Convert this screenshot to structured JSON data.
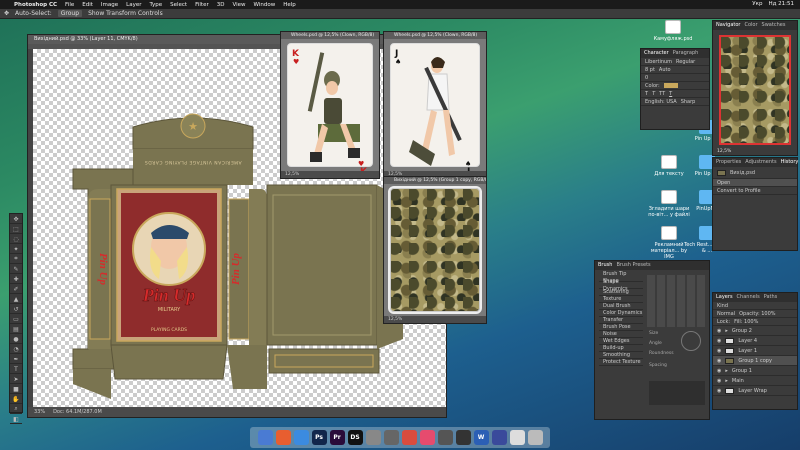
{
  "menubar": {
    "app": "Photoshop CC",
    "items": [
      "File",
      "Edit",
      "Image",
      "Layer",
      "Type",
      "Select",
      "Filter",
      "3D",
      "View",
      "Window",
      "Help"
    ],
    "status": [
      "Укр",
      "Нд 21:51"
    ]
  },
  "options": {
    "auto_select": "Auto-Select:",
    "group": "Group",
    "transform": "Show Transform Controls"
  },
  "main_doc": {
    "title": "Вихідний.psd @ 33% (Layer 11, CMYK/8)",
    "zoom": "33%",
    "doc_size": "Doc: 64.1M/287.0M"
  },
  "card1": {
    "title": "Wheels.psd @ 12,5% (Сlown, RGB/8)",
    "zoom": "12,5%"
  },
  "card2": {
    "title": "Wheels.psd @ 12,5% (Сlown, RGB/8)",
    "zoom": "12,5%"
  },
  "card3": {
    "title": "Вихідний @ 12,5% (Group 1 copy, RGB/8)",
    "zoom": "12,5%"
  },
  "box": {
    "brand": "Pin Up",
    "subtitle": "MILITARY",
    "playing": "PLAYING CARDS",
    "topline": "AMERICAN VINTAGE PLAYING CARDS"
  },
  "desktop_icons": [
    {
      "label": "Камуфляж.psd",
      "kind": "doc"
    },
    {
      "label": "Pin Up Mil",
      "kind": "folder"
    },
    {
      "label": "Для тексту",
      "kind": "doc"
    },
    {
      "label": "Pin Up Mil",
      "kind": "folder"
    },
    {
      "label": "Згладити шари по-віт... у файлі",
      "kind": "doc"
    },
    {
      "label": "PinUpMil",
      "kind": "folder"
    },
    {
      "label": "Рекламний матеріал... by IMG",
      "kind": "doc"
    },
    {
      "label": "Tech Rest... Hands & ...",
      "kind": "folder"
    }
  ],
  "navigator": {
    "tabs": [
      "Navigator",
      "Color",
      "Swatches"
    ],
    "zoom": "12,5%"
  },
  "character": {
    "tabs": [
      "Character",
      "Paragraph"
    ],
    "font": "Libertinum",
    "style": "Regular",
    "size": "8 pt",
    "leading": "Auto",
    "tracking": "0",
    "color_label": "Color:",
    "lang": "English: USA",
    "aa": "Sharp"
  },
  "history": {
    "tabs": [
      "Properties",
      "Adjustments",
      "History"
    ],
    "file": "Вихід.psd",
    "items": [
      "Open",
      "Convert to Profile"
    ]
  },
  "brush": {
    "tabs": [
      "Brush",
      "Brush Presets"
    ],
    "settings": [
      "Brush Tip Shape",
      "Shape Dynamics",
      "Scattering",
      "Texture",
      "Dual Brush",
      "Color Dynamics",
      "Transfer",
      "Brush Pose",
      "Noise",
      "Wet Edges",
      "Build-up",
      "Smoothing",
      "Protect Texture"
    ],
    "spacing": "Spacing",
    "size": "Size",
    "angle": "Angle",
    "roundness": "Roundness"
  },
  "layers": {
    "tabs": [
      "Layers",
      "Channels",
      "Paths"
    ],
    "kind": "Kind",
    "blend": "Normal",
    "opacity": "Opacity: 100%",
    "fill": "Fill: 100%",
    "lock": "Lock:",
    "items": [
      {
        "name": "Group 2"
      },
      {
        "name": "Layer 4"
      },
      {
        "name": "Layer 1"
      },
      {
        "name": "Group 1 copy"
      },
      {
        "name": "Group 1"
      },
      {
        "name": "Main"
      },
      {
        "name": "Layer Wrap"
      }
    ]
  },
  "dock": [
    {
      "label": "",
      "color": "#4a7bd3"
    },
    {
      "label": "",
      "color": "#e85e30"
    },
    {
      "label": "",
      "color": "#3b8be0"
    },
    {
      "label": "Ps",
      "color": "#11264b"
    },
    {
      "label": "Pr",
      "color": "#2a0b3a"
    },
    {
      "label": "DS",
      "color": "#111"
    },
    {
      "label": "",
      "color": "#888"
    },
    {
      "label": "",
      "color": "#666"
    },
    {
      "label": "",
      "color": "#d94c3e"
    },
    {
      "label": "",
      "color": "#e64b6e"
    },
    {
      "label": "",
      "color": "#555"
    },
    {
      "label": "",
      "color": "#333"
    },
    {
      "label": "W",
      "color": "#2b5fb5"
    },
    {
      "label": "",
      "color": "#3a4a9b"
    },
    {
      "label": "",
      "color": "#ddd"
    },
    {
      "label": "",
      "color": "#bbb"
    }
  ]
}
